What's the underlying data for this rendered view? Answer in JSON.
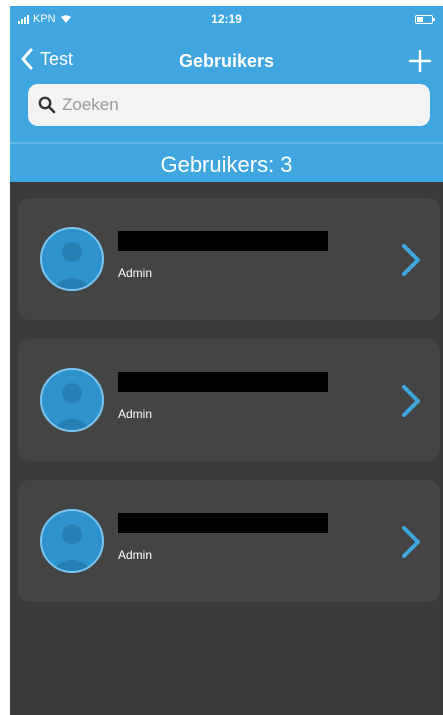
{
  "status_bar": {
    "carrier": "KPN",
    "time": "12:19"
  },
  "nav": {
    "back_label": "Test",
    "title": "Gebruikers",
    "add_icon": "plus-icon",
    "back_icon": "chevron-left-icon"
  },
  "search": {
    "placeholder": "Zoeken",
    "value": "",
    "icon": "search-icon"
  },
  "summary": {
    "count_label": "Gebruikers: 3"
  },
  "users": [
    {
      "name": "",
      "role": "Admin",
      "avatar_icon": "person-silhouette-icon",
      "chevron_icon": "chevron-right-icon"
    },
    {
      "name": "",
      "role": "Admin",
      "avatar_icon": "person-silhouette-icon",
      "chevron_icon": "chevron-right-icon"
    },
    {
      "name": "",
      "role": "Admin",
      "avatar_icon": "person-silhouette-icon",
      "chevron_icon": "chevron-right-icon"
    }
  ],
  "colors": {
    "header": "#3fa6df",
    "background": "#3a3a3a",
    "card": "#444444",
    "accent": "#2e93cd",
    "redaction": "#000000"
  }
}
